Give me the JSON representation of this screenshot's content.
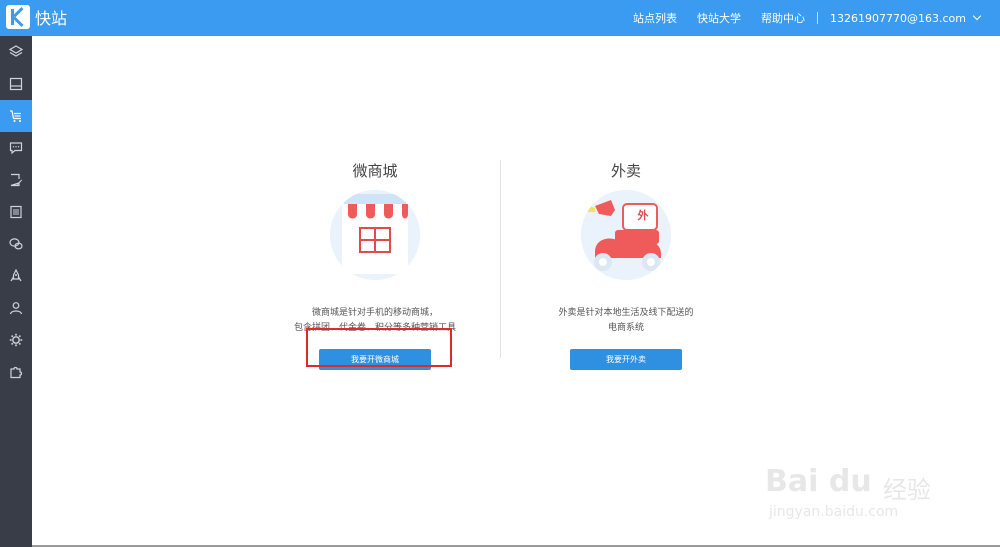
{
  "app": {
    "name": "快站",
    "accent": "#3a9bf0",
    "sidebar_bg": "#383d48"
  },
  "topnav": {
    "site_list": "站点列表",
    "university": "快站大学",
    "help": "帮助中心",
    "account": "13261907770@163.com"
  },
  "sidebar": {
    "items": [
      {
        "icon": "layers-icon"
      },
      {
        "icon": "layout-icon"
      },
      {
        "icon": "cart-icon",
        "active": true
      },
      {
        "icon": "message-icon"
      },
      {
        "icon": "edit-page-icon"
      },
      {
        "icon": "list-icon"
      },
      {
        "icon": "wechat-icon"
      },
      {
        "icon": "rocket-icon"
      },
      {
        "icon": "user-icon"
      },
      {
        "icon": "settings-icon"
      },
      {
        "icon": "plugin-icon"
      }
    ]
  },
  "cards": {
    "mall": {
      "title": "微商城",
      "desc_line1": "微商城是针对手机的移动商城，",
      "desc_line2": "包含拼团、代金卷、积分等多种营销工具",
      "button": "我要开微商城"
    },
    "takeout": {
      "title": "外卖",
      "badge": "外",
      "desc_line1": "外卖是针对本地生活及线下配送的",
      "desc_line2": "电商系统",
      "button": "我要开外卖"
    }
  },
  "watermark": {
    "brand": "Bai du",
    "cn": "经验",
    "sub": "jingyan.baidu.com"
  }
}
